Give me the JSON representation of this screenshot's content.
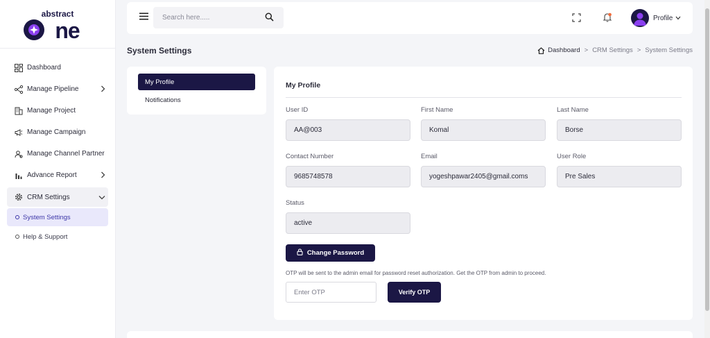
{
  "sidebar": {
    "logo_top": "abstract",
    "logo_bottom": "one",
    "items": [
      {
        "label": "Dashboard",
        "icon": "dashboard-icon"
      },
      {
        "label": "Manage Pipeline",
        "icon": "pipeline-icon"
      },
      {
        "label": "Manage Project",
        "icon": "building-icon"
      },
      {
        "label": "Manage Campaign",
        "icon": "megaphone-icon"
      },
      {
        "label": "Manage Channel Partner",
        "icon": "partner-icon"
      },
      {
        "label": "Advance Report",
        "icon": "bar-chart-icon"
      },
      {
        "label": "CRM Settings",
        "icon": "gear-icon"
      }
    ],
    "sub_items": [
      {
        "label": "System Settings"
      },
      {
        "label": "Help & Support"
      }
    ]
  },
  "topbar": {
    "search_placeholder": "Search here.....",
    "profile_label": "Profile"
  },
  "page": {
    "title": "System Settings",
    "breadcrumb": [
      "Dashboard",
      "CRM Settings",
      "System Settings"
    ],
    "breadcrumb_sep": ">"
  },
  "settings_menu": [
    "My Profile",
    "Notifications"
  ],
  "profile": {
    "title": "My Profile",
    "fields": [
      {
        "label": "User ID",
        "value": "AA@003"
      },
      {
        "label": "First Name",
        "value": "Komal"
      },
      {
        "label": "Last Name",
        "value": "Borse"
      },
      {
        "label": "Contact Number",
        "value": "9685748578"
      },
      {
        "label": "Email",
        "value": "yogeshpawar2405@gmail.coms"
      },
      {
        "label": "User Role",
        "value": "Pre Sales"
      },
      {
        "label": "Status",
        "value": "active"
      }
    ],
    "change_password_label": "Change Password",
    "otp_note": "OTP will be sent to the admin email for password reset authorization. Get the OTP from admin to proceed.",
    "otp_placeholder": "Enter OTP",
    "verify_label": "Verify OTP"
  },
  "colors": {
    "brand_dark": "#1b1745",
    "brand_accent": "#7b3fe4",
    "active_sub_bg": "#e9e8fb",
    "notification_dot": "#f26b3a"
  }
}
